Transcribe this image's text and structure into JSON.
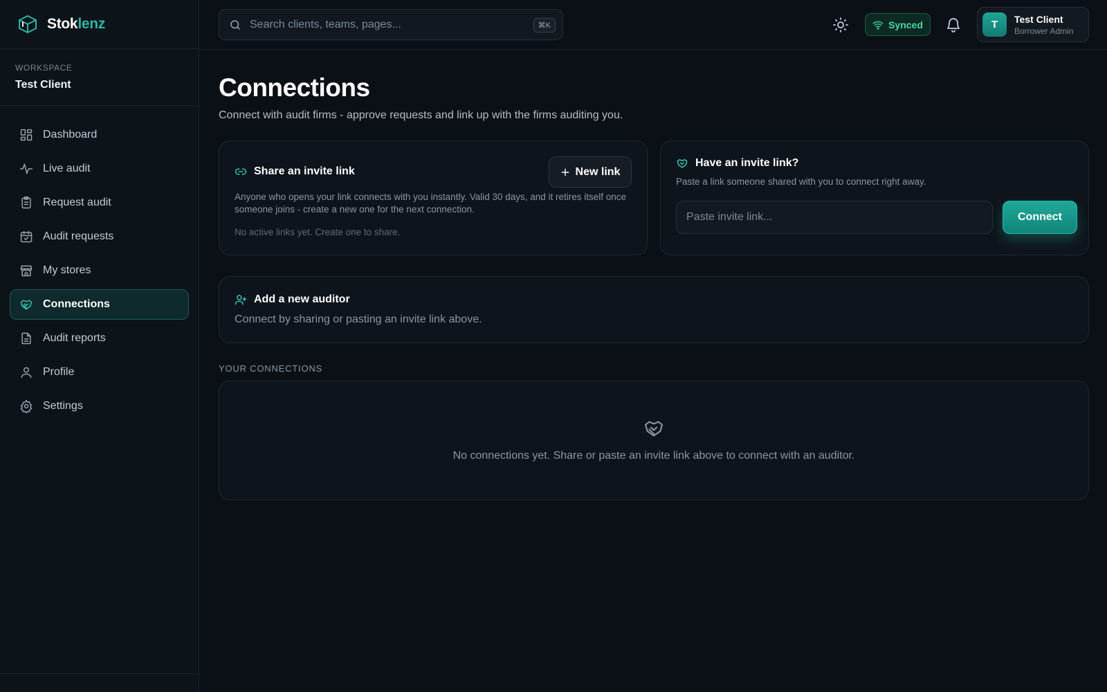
{
  "brand": {
    "name_part1": "Stok",
    "name_part2": "lenz"
  },
  "workspace": {
    "label": "WORKSPACE",
    "name": "Test Client"
  },
  "sidebar": {
    "items": [
      {
        "label": "Dashboard",
        "icon": "dashboard-icon"
      },
      {
        "label": "Live audit",
        "icon": "activity-icon"
      },
      {
        "label": "Request audit",
        "icon": "clipboard-icon"
      },
      {
        "label": "Audit requests",
        "icon": "calendar-check-icon"
      },
      {
        "label": "My stores",
        "icon": "store-icon"
      },
      {
        "label": "Connections",
        "icon": "handshake-icon",
        "active": true
      },
      {
        "label": "Audit reports",
        "icon": "file-text-icon"
      },
      {
        "label": "Profile",
        "icon": "user-icon"
      },
      {
        "label": "Settings",
        "icon": "gear-icon"
      }
    ]
  },
  "topbar": {
    "search_placeholder": "Search clients, teams, pages...",
    "search_shortcut": "⌘K",
    "sync_status": "Synced",
    "user": {
      "initial": "T",
      "name": "Test Client",
      "role": "Borrower Admin"
    }
  },
  "page": {
    "title": "Connections",
    "subtitle": "Connect with audit firms - approve requests and link up with the firms auditing you."
  },
  "share_card": {
    "title": "Share an invite link",
    "button": "New link",
    "description": "Anyone who opens your link connects with you instantly. Valid 30 days, and it retires itself once someone joins - create a new one for the next connection.",
    "empty": "No active links yet. Create one to share."
  },
  "invite_card": {
    "title": "Have an invite link?",
    "description": "Paste a link someone shared with you to connect right away.",
    "placeholder": "Paste invite link...",
    "button": "Connect"
  },
  "auditor_card": {
    "title": "Add a new auditor",
    "description": "Connect by sharing or pasting an invite link above."
  },
  "connections": {
    "section_label": "YOUR CONNECTIONS",
    "empty": "No connections yet. Share or paste an invite link above to connect with an auditor."
  },
  "colors": {
    "accent": "#2bb5a6",
    "synced": "#48d6a0",
    "background": "#0b1017"
  }
}
